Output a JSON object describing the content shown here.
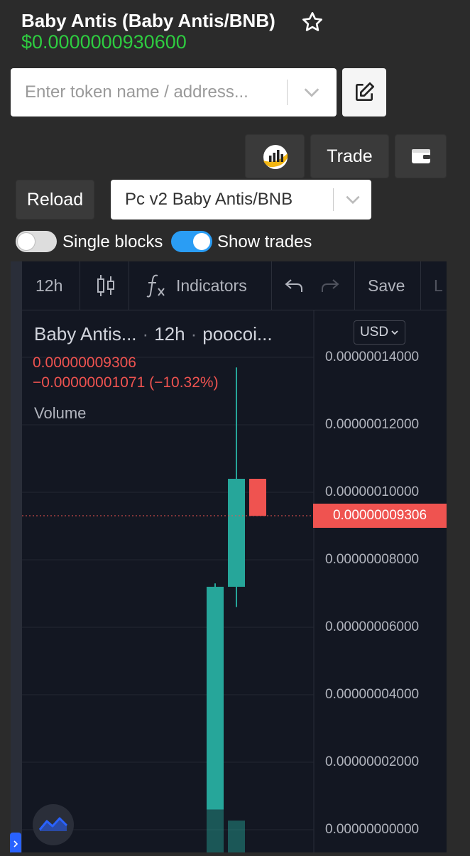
{
  "header": {
    "title": "Baby Antis (Baby Antis/BNB)",
    "price": "$0.0000000930600"
  },
  "search": {
    "placeholder": "Enter token name / address..."
  },
  "buttons": {
    "trade": "Trade",
    "reload": "Reload"
  },
  "pair_select": {
    "selected": "Pc v2 Baby Antis/BNB"
  },
  "toggles": {
    "single_blocks": {
      "label": "Single blocks",
      "on": false
    },
    "show_trades": {
      "label": "Show trades",
      "on": true
    }
  },
  "chart_toolbar": {
    "interval": "12h",
    "indicators": "Indicators",
    "save": "Save",
    "cut_label": "L"
  },
  "chart_legend": {
    "symbol": "Baby Antis...",
    "interval": "12h",
    "source": "poocoi...",
    "separator": "·",
    "last_price": "0.00000009306",
    "change": "−0.00000001071 (−10.32%)",
    "volume_label": "Volume"
  },
  "currency": "USD",
  "colors": {
    "up": "#26a69a",
    "down": "#ef5350",
    "price_green": "#2ecc40",
    "toggle_on": "#2a9df4"
  },
  "chart_data": {
    "type": "candlestick",
    "y_ticks": [
      "0.00000014000",
      "0.00000012000",
      "0.00000010000",
      "0.00000008000",
      "0.00000006000",
      "0.00000004000",
      "0.00000002000",
      "0.00000000000"
    ],
    "ylim": [
      0,
      1.4e-07
    ],
    "last_price_label": "0.00000009306",
    "last_price": 9.306e-08,
    "candles": [
      {
        "open": 6e-09,
        "high": 7.3e-08,
        "low": 6e-09,
        "close": 7.2e-08,
        "volume_frac": 0.33
      },
      {
        "open": 7.2e-08,
        "high": 1.37e-07,
        "low": 6.6e-08,
        "close": 1.04e-07,
        "volume_frac": 0.08
      },
      {
        "open": 1.04e-07,
        "high": 1.04e-07,
        "low": 9.3e-08,
        "close": 9.3e-08,
        "volume_frac": 0.0
      }
    ]
  }
}
